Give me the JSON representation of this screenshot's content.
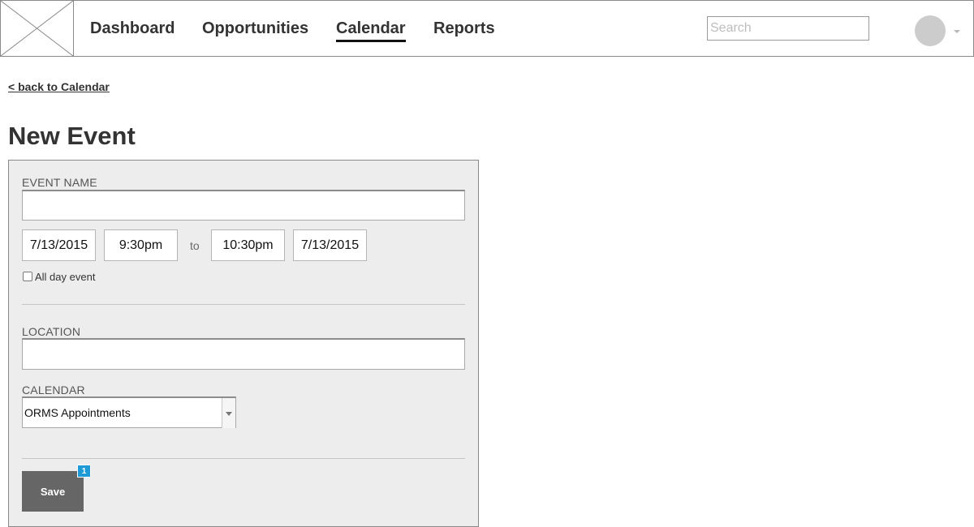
{
  "nav": {
    "items": [
      {
        "label": "Dashboard"
      },
      {
        "label": "Opportunities"
      },
      {
        "label": "Calendar",
        "active": true
      },
      {
        "label": "Reports"
      }
    ],
    "search_placeholder": "Search",
    "logo_icon": "image-placeholder-icon",
    "user_icon": "avatar"
  },
  "back_link": "< back to Calendar",
  "page_title": "New Event",
  "form": {
    "event_name_label": "EVENT NAME",
    "event_name_value": "",
    "start_date": "7/13/2015",
    "start_time": "9:30pm",
    "to_label": "to",
    "end_time": "10:30pm",
    "end_date": "7/13/2015",
    "all_day_label": "All day event",
    "all_day_checked": false,
    "location_label": "LOCATION",
    "location_value": "",
    "calendar_label": "CALENDAR",
    "calendar_value": "ORMS Appointments",
    "save_label": "Save",
    "save_badge": "1"
  },
  "colors": {
    "panel_bg": "#ededed",
    "button_bg": "#666666",
    "badge_bg": "#1e9bd7"
  }
}
